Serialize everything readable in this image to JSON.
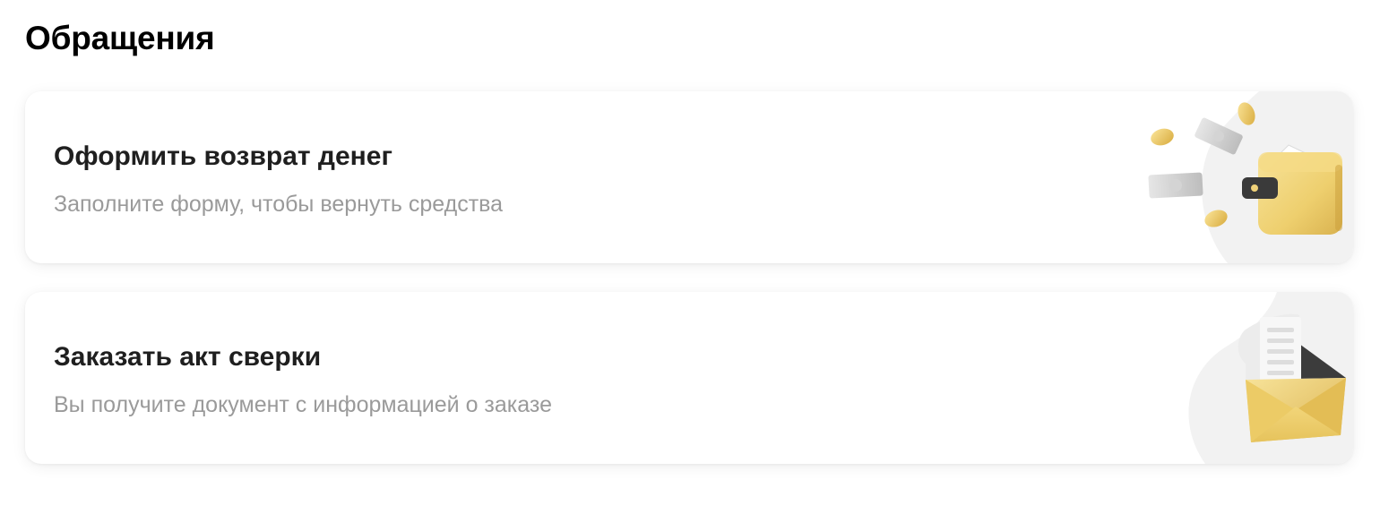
{
  "page": {
    "title": "Обращения"
  },
  "cards": [
    {
      "title": "Оформить возврат денег",
      "subtitle": "Заполните форму, чтобы вернуть средства",
      "icon": "wallet-coins-icon"
    },
    {
      "title": "Заказать акт сверки",
      "subtitle": "Вы получите документ с информацией о заказе",
      "icon": "envelope-document-icon"
    }
  ],
  "colors": {
    "title": "#000000",
    "card_title": "#1f1f1f",
    "card_subtitle": "#9a9a9a",
    "illustration_bg": "#f2f2f2",
    "accent_gold": "#f0d27a"
  }
}
